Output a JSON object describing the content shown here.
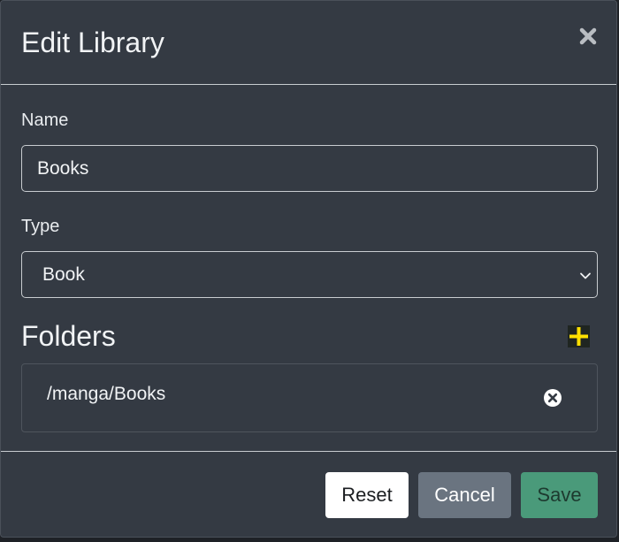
{
  "modal": {
    "title": "Edit Library",
    "close_icon": "close-icon"
  },
  "form": {
    "name_label": "Name",
    "name_value": "Books",
    "type_label": "Type",
    "type_value": "Book",
    "type_icon": "chevron-down-icon"
  },
  "folders": {
    "title": "Folders",
    "add_icon": "plus-icon",
    "add_icon_color": "#ffe000",
    "items": [
      {
        "path": "/manga/Books",
        "remove_icon": "remove-circle-icon"
      }
    ]
  },
  "footer": {
    "reset_label": "Reset",
    "cancel_label": "Cancel",
    "save_label": "Save"
  },
  "colors": {
    "modal_bg": "#343a43",
    "save_button": "#4a9a7a",
    "cancel_button": "#6a7480",
    "reset_button": "#ffffff"
  }
}
